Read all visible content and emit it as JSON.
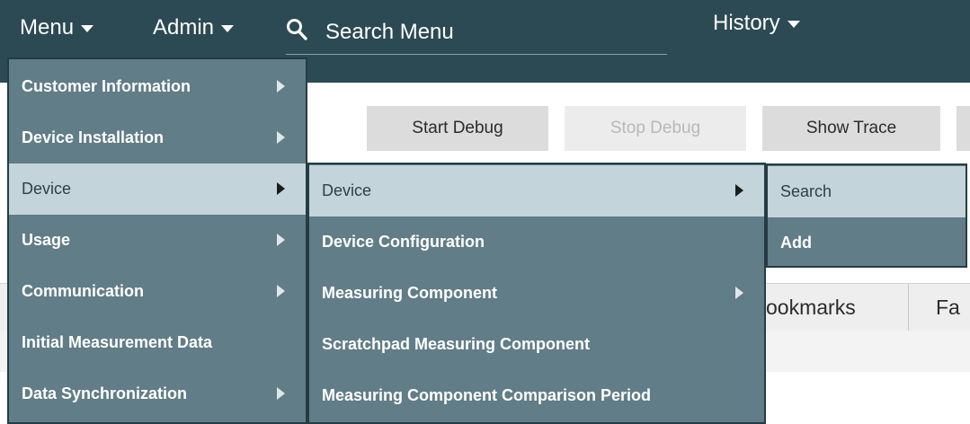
{
  "topbar": {
    "menu_label": "Menu",
    "admin_label": "Admin",
    "search_placeholder": "Search Menu",
    "history_label": "History"
  },
  "toolbar": {
    "buttons": [
      {
        "label": "Start Debug",
        "enabled": true
      },
      {
        "label": "Stop Debug",
        "enabled": false
      },
      {
        "label": "Show Trace",
        "enabled": true
      }
    ]
  },
  "tabs": [
    {
      "label": "ookmarks"
    },
    {
      "label": "Fa"
    }
  ],
  "menu_level1": {
    "items": [
      {
        "label": "Customer Information",
        "has_submenu": true
      },
      {
        "label": "Device Installation",
        "has_submenu": true
      },
      {
        "label": "Device",
        "has_submenu": true,
        "active": true
      },
      {
        "label": "Usage",
        "has_submenu": true
      },
      {
        "label": "Communication",
        "has_submenu": true
      },
      {
        "label": "Initial Measurement Data",
        "has_submenu": false
      },
      {
        "label": "Data Synchronization",
        "has_submenu": true
      }
    ]
  },
  "menu_level2": {
    "items": [
      {
        "label": "Device",
        "has_submenu": true,
        "active": true
      },
      {
        "label": "Device Configuration",
        "has_submenu": false
      },
      {
        "label": "Measuring Component",
        "has_submenu": true
      },
      {
        "label": "Scratchpad Measuring Component",
        "has_submenu": false
      },
      {
        "label": "Measuring Component Comparison Period",
        "has_submenu": false
      }
    ]
  },
  "menu_level3": {
    "items": [
      {
        "label": "Search",
        "active": true
      },
      {
        "label": "Add"
      }
    ]
  },
  "colors": {
    "topbar_bg": "#2c4a53",
    "menu_bg": "#617d87",
    "menu_active_bg": "#c3d5db"
  }
}
